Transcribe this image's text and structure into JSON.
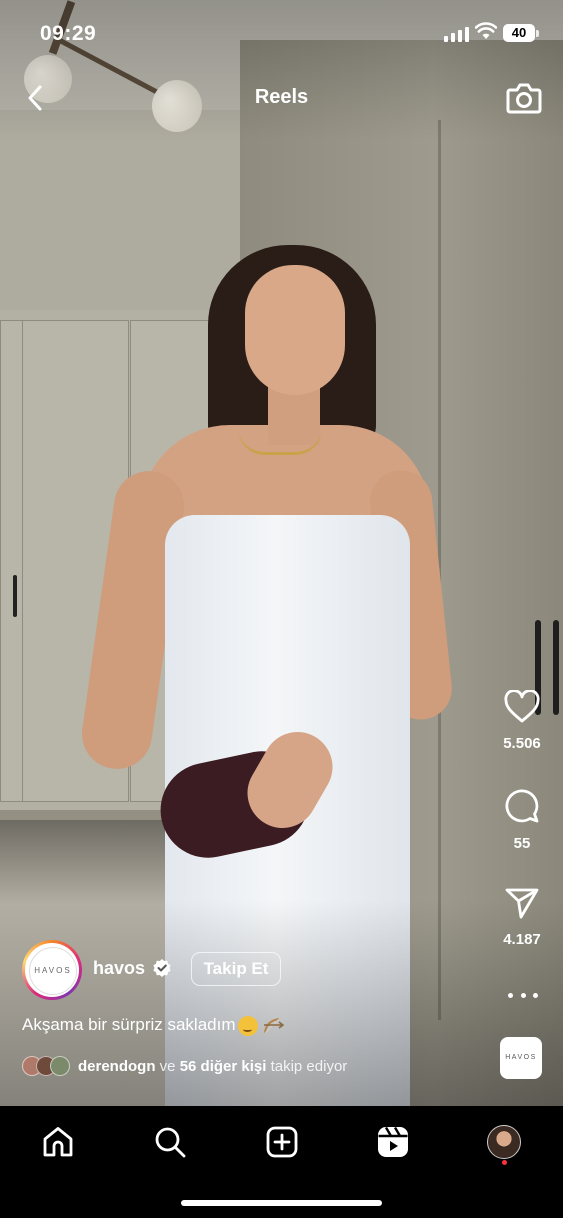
{
  "status_bar": {
    "time": "09:29",
    "battery": "40"
  },
  "header": {
    "title": "Reels"
  },
  "actions": {
    "likes": "5.506",
    "comments": "55",
    "shares": "4.187"
  },
  "post": {
    "username": "havos",
    "avatar_text": "HAVOS",
    "follow_label": "Takip Et",
    "caption": "Akşama bir sürpriz sakladım",
    "followed_by_name": "derendogn",
    "followed_by_connector": "ve",
    "followed_by_others": "56 diğer kişi",
    "followed_by_suffix": "takip ediyor"
  },
  "audio": {
    "thumb_text": "HAVOS"
  },
  "colors": {
    "background": "#000000",
    "notification": "#ff3040",
    "verified": "#ffffff"
  },
  "icons": [
    "back-icon",
    "camera-icon",
    "heart-icon",
    "comment-icon",
    "send-icon",
    "more-icon",
    "verified-icon",
    "home-icon",
    "search-icon",
    "create-icon",
    "reels-icon"
  ]
}
